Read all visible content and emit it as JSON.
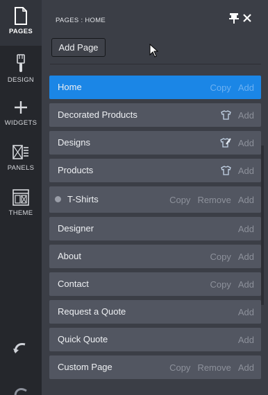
{
  "rail": {
    "items": [
      {
        "label": "PAGES",
        "icon": "page-icon"
      },
      {
        "label": "DESIGN",
        "icon": "brush-icon"
      },
      {
        "label": "WIDGETS",
        "icon": "plus-icon"
      },
      {
        "label": "PANELS",
        "icon": "panels-icon"
      },
      {
        "label": "THEME",
        "icon": "theme-icon"
      }
    ],
    "undo_icon": "undo-icon"
  },
  "panel": {
    "title": "PAGES : HOME",
    "add_page_label": "Add Page"
  },
  "pages": [
    {
      "label": "Home",
      "actions": [
        "Copy",
        "Add"
      ],
      "active": true
    },
    {
      "label": "Decorated Products",
      "icon": "tshirt-icon",
      "actions": [
        "Add"
      ]
    },
    {
      "label": "Designs",
      "icon": "tshirt-brush-icon",
      "actions": [
        "Add"
      ]
    },
    {
      "label": "Products",
      "icon": "tshirt-icon",
      "actions": [
        "Add"
      ]
    },
    {
      "label": "T-Shirts",
      "actions": [
        "Copy",
        "Remove",
        "Add"
      ]
    },
    {
      "label": "Designer",
      "actions": [
        "Add"
      ]
    },
    {
      "label": "About",
      "actions": [
        "Copy",
        "Add"
      ]
    },
    {
      "label": "Contact",
      "actions": [
        "Copy",
        "Add"
      ]
    },
    {
      "label": "Request a Quote",
      "actions": [
        "Add"
      ]
    },
    {
      "label": "Quick Quote",
      "actions": [
        "Add"
      ]
    },
    {
      "label": "Custom Page",
      "actions": [
        "Copy",
        "Remove",
        "Add"
      ]
    }
  ],
  "colors": {
    "rail_bg": "#25272c",
    "panel_bg": "#3b3e46",
    "row_bg": "#525661",
    "active_row": "#1b86e6",
    "action_text": "#8d919b"
  }
}
